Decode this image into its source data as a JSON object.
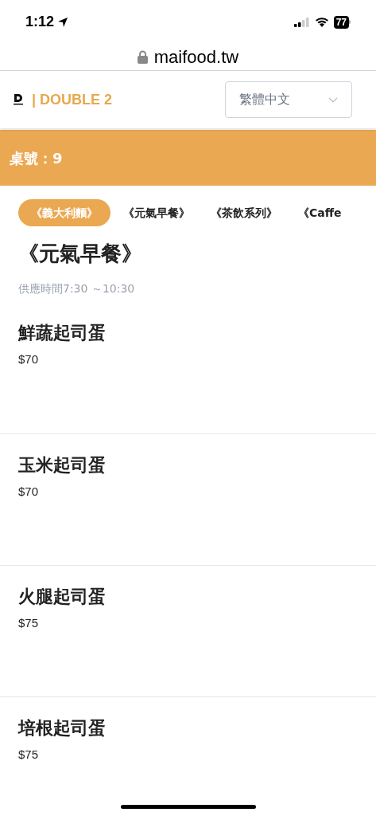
{
  "status_bar": {
    "time": "1:12",
    "battery": "77"
  },
  "address_bar": {
    "url": "maifood.tw"
  },
  "header": {
    "brand": "| DOUBLE 2",
    "language": "繁體中文"
  },
  "table_banner": {
    "label": "桌號：9"
  },
  "tabs": [
    {
      "label": "《義大利麵》",
      "selected": true
    },
    {
      "label": "《元氣早餐》",
      "selected": false
    },
    {
      "label": "《茶飲系列》",
      "selected": false
    },
    {
      "label": "《Caffe",
      "selected": false
    }
  ],
  "section": {
    "title": "《元氣早餐》",
    "hours": "供應時間7:30 ～10:30"
  },
  "items": [
    {
      "name": "鮮蔬起司蛋",
      "price": "$70"
    },
    {
      "name": "玉米起司蛋",
      "price": "$70"
    },
    {
      "name": "火腿起司蛋",
      "price": "$75"
    },
    {
      "name": "培根起司蛋",
      "price": "$75"
    }
  ]
}
